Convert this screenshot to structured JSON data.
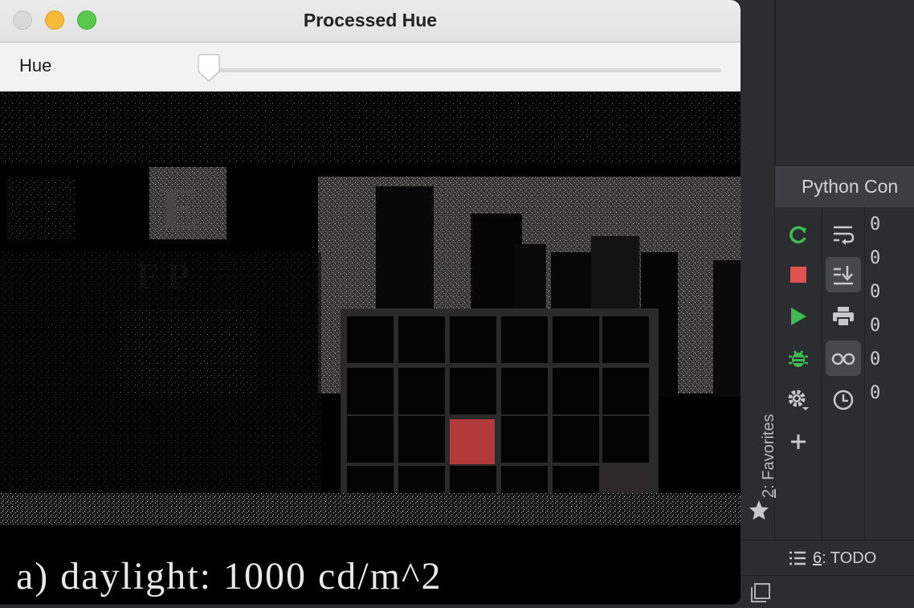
{
  "window": {
    "title": "Processed Hue",
    "traffic_lights": [
      "close",
      "minimize",
      "maximize"
    ]
  },
  "toolbar": {
    "slider_label": "Hue",
    "slider_value_fraction": 0.0
  },
  "image": {
    "caption": "a) daylight: 1000 cd/m^2",
    "chart_letters": [
      "E",
      "F P"
    ]
  },
  "ide": {
    "console_title": "Python Con",
    "console_lines": [
      "0",
      "0",
      "0",
      "0",
      "0",
      "0"
    ],
    "favorites_number": "2",
    "favorites_label": ": Favorites",
    "todo_number": "6",
    "todo_label": ": TODO",
    "colors": {
      "rerun": "#3fb950",
      "stop": "#e05252",
      "run": "#3fb950",
      "debug": "#3fb950",
      "accent_red_patch": "#b33a3a"
    }
  }
}
